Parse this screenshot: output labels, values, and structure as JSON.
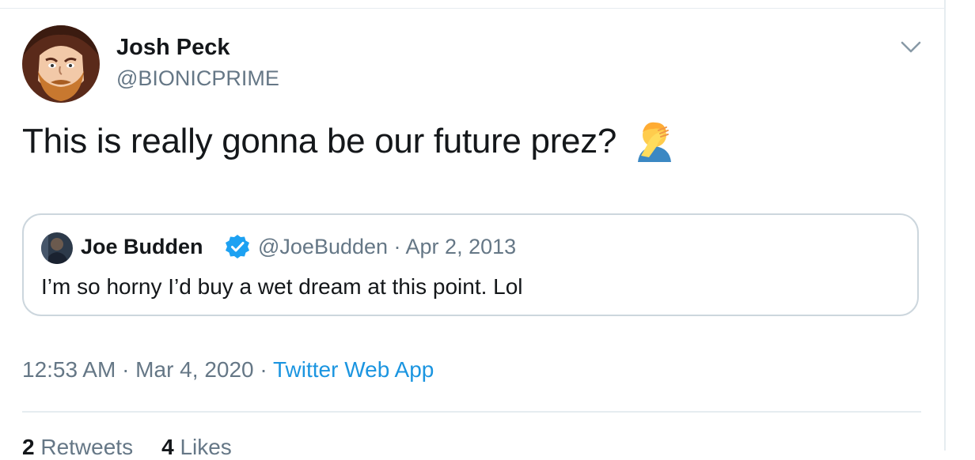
{
  "tweet": {
    "author": {
      "name": "Josh Peck",
      "handle": "@BIONICPRIME"
    },
    "text": "This is really gonna be our future prez?",
    "emoji": "face-palm-emoji",
    "quoted": {
      "name": "Joe Budden",
      "meta": "@JoeBudden · Apr 2, 2013",
      "text": "I’m so horny I’d buy a wet dream at this point. Lol"
    },
    "time": "12:53 AM · Mar 4, 2020 · ",
    "app": "Twitter Web App",
    "stats": {
      "retweets_count": "2",
      "retweets_label": "Retweets",
      "likes_count": "4",
      "likes_label": "Likes"
    }
  },
  "icons": {
    "caret": "chevron-down-icon",
    "verified": "verified-badge-icon"
  },
  "colors": {
    "link": "#1b95e0",
    "secondary_text": "#657786",
    "border": "#ccd6dd",
    "verified": "#1da1f2"
  }
}
